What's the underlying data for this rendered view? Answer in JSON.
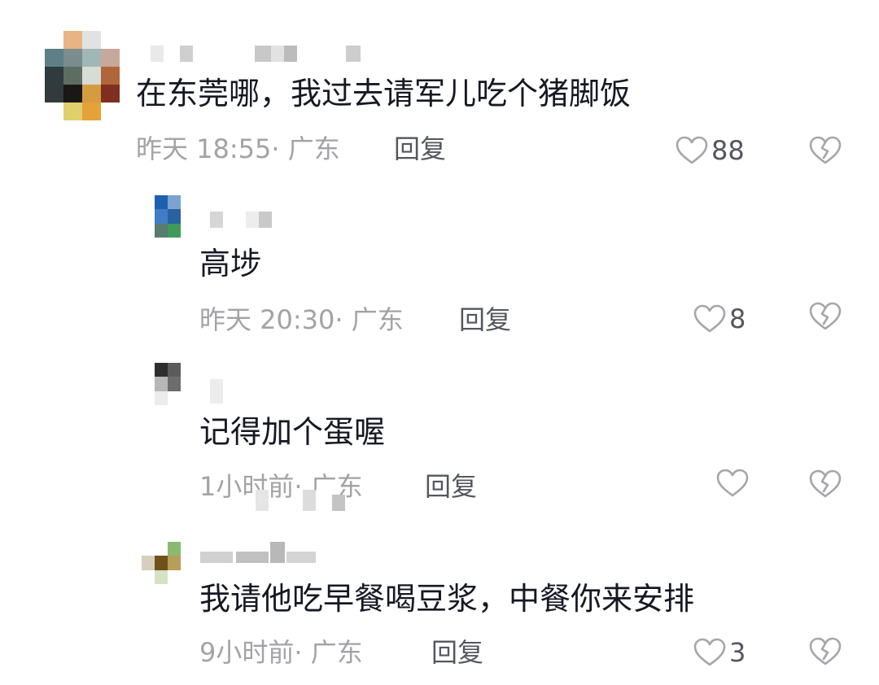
{
  "comments": [
    {
      "text": "在东莞哪，我过去请军儿吃个猪脚饭",
      "time": "昨天 18:55",
      "location": "广东",
      "reply_label": "回复",
      "likes": "88"
    },
    {
      "text": "高埗",
      "time": "昨天 20:30",
      "location": "广东",
      "reply_label": "回复",
      "likes": "8"
    },
    {
      "text": "记得加个蛋喔",
      "time": "1小时前",
      "location": "广东",
      "reply_label": "回复",
      "likes": ""
    },
    {
      "text": "我请他吃早餐喝豆浆，中餐你来安排",
      "time": "9小时前",
      "location": "广东",
      "reply_label": "回复",
      "likes": "3"
    }
  ],
  "meta_separator": "·",
  "icons": {
    "like": "heart-outline-icon",
    "dislike": "broken-heart-icon"
  },
  "colors": {
    "text": "#161823",
    "meta": "#a3a3a7",
    "action": "#55575e"
  }
}
